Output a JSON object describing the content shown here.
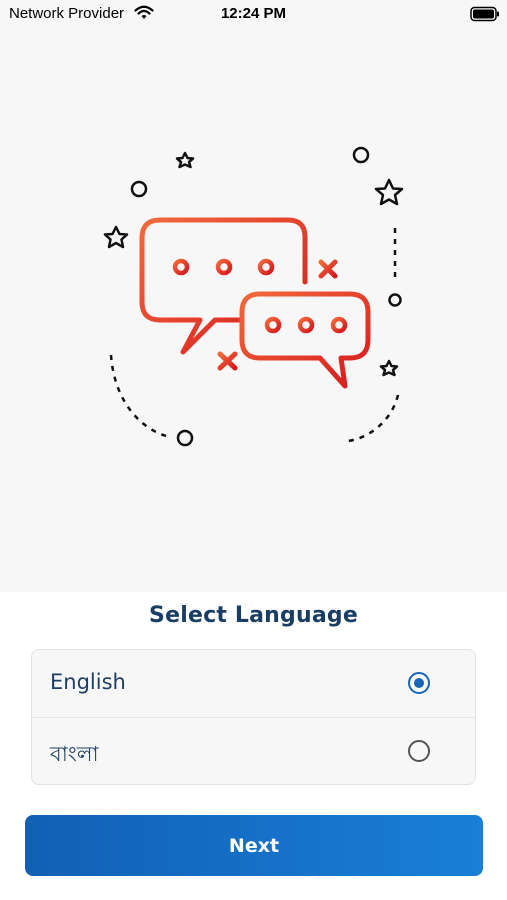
{
  "status_bar": {
    "carrier": "Network Provider",
    "time": "12:24 PM"
  },
  "illustration": {
    "accent_start": "#f0623a",
    "accent_end": "#d91c1c",
    "decoration_color": "#111111"
  },
  "language_select": {
    "title": "Select Language",
    "options": [
      {
        "label": "English",
        "selected": true
      },
      {
        "label": "বাংলা",
        "selected": false
      }
    ]
  },
  "actions": {
    "next_label": "Next"
  },
  "colors": {
    "primary": "#1565b8",
    "title": "#1a3d63",
    "background": "#f7f7f7"
  }
}
